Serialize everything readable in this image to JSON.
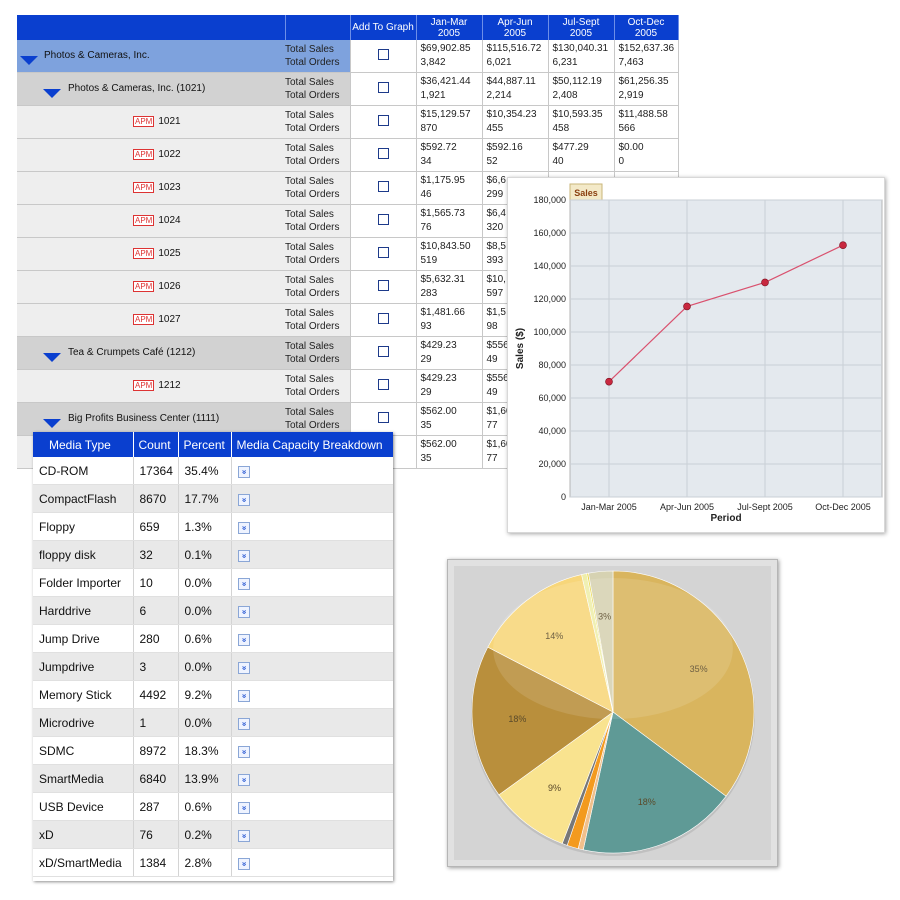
{
  "sales_table": {
    "headers": {
      "add_to_graph": "Add To Graph",
      "q1": "Jan-Mar\n2005",
      "q2": "Apr-Jun\n2005",
      "q3": "Jul-Sept\n2005",
      "q4": "Oct-Dec\n2005"
    },
    "metric_sales": "Total Sales",
    "metric_orders": "Total Orders",
    "rows": [
      {
        "level": 0,
        "name": "Photos & Cameras, Inc.",
        "apm": false,
        "sales": [
          "$69,902.85",
          "$115,516.72",
          "$130,040.31",
          "$152,637.36"
        ],
        "orders": [
          "3,842",
          "6,021",
          "6,231",
          "7,463"
        ]
      },
      {
        "level": 1,
        "name": "Photos & Cameras, Inc. (1021)",
        "apm": false,
        "sales": [
          "$36,421.44",
          "$44,887.11",
          "$50,112.19",
          "$61,256.35"
        ],
        "orders": [
          "1,921",
          "2,214",
          "2,408",
          "2,919"
        ]
      },
      {
        "level": 2,
        "name": "1021",
        "apm": true,
        "sales": [
          "$15,129.57",
          "$10,354.23",
          "$10,593.35",
          "$11,488.58"
        ],
        "orders": [
          "870",
          "455",
          "458",
          "566"
        ]
      },
      {
        "level": 2,
        "name": "1022",
        "apm": true,
        "sales": [
          "$592.72",
          "$592.16",
          "$477.29",
          "$0.00"
        ],
        "orders": [
          "34",
          "52",
          "40",
          "0"
        ]
      },
      {
        "level": 2,
        "name": "1023",
        "apm": true,
        "sales": [
          "$1,175.95",
          "$6,6",
          "",
          ""
        ],
        "orders": [
          "46",
          "299",
          "",
          ""
        ]
      },
      {
        "level": 2,
        "name": "1024",
        "apm": true,
        "sales": [
          "$1,565.73",
          "$6,4",
          "",
          ""
        ],
        "orders": [
          "76",
          "320",
          "",
          ""
        ]
      },
      {
        "level": 2,
        "name": "1025",
        "apm": true,
        "sales": [
          "$10,843.50",
          "$8,5",
          "",
          ""
        ],
        "orders": [
          "519",
          "393",
          "",
          ""
        ]
      },
      {
        "level": 2,
        "name": "1026",
        "apm": true,
        "sales": [
          "$5,632.31",
          "$10,",
          "",
          ""
        ],
        "orders": [
          "283",
          "597",
          "",
          ""
        ]
      },
      {
        "level": 2,
        "name": "1027",
        "apm": true,
        "sales": [
          "$1,481.66",
          "$1,5",
          "",
          ""
        ],
        "orders": [
          "93",
          "98",
          "",
          ""
        ]
      },
      {
        "level": 1,
        "name": "Tea & Crumpets Café (1212)",
        "apm": false,
        "sales": [
          "$429.23",
          "$556",
          "",
          ""
        ],
        "orders": [
          "29",
          "49",
          "",
          ""
        ]
      },
      {
        "level": 2,
        "name": "1212",
        "apm": true,
        "sales": [
          "$429.23",
          "$556",
          "",
          ""
        ],
        "orders": [
          "29",
          "49",
          "",
          ""
        ]
      },
      {
        "level": 1,
        "name": "Big Profits Business Center (1111)",
        "apm": false,
        "sales": [
          "$562.00",
          "$1,60",
          "",
          ""
        ],
        "orders": [
          "35",
          "77",
          "",
          ""
        ]
      },
      {
        "level": 2,
        "name": "",
        "apm": false,
        "sales": [
          "$562.00",
          "$1,60",
          "",
          ""
        ],
        "orders": [
          "35",
          "77",
          "",
          ""
        ]
      }
    ]
  },
  "media_table": {
    "headers": [
      "Media Type",
      "Count",
      "Percent",
      "Media Capacity Breakdown"
    ],
    "rows": [
      [
        "CD-ROM",
        "17364",
        "35.4%"
      ],
      [
        "CompactFlash",
        "8670",
        "17.7%"
      ],
      [
        "Floppy",
        "659",
        "1.3%"
      ],
      [
        "floppy disk",
        "32",
        "0.1%"
      ],
      [
        "Folder Importer",
        "10",
        "0.0%"
      ],
      [
        "Harddrive",
        "6",
        "0.0%"
      ],
      [
        "Jump Drive",
        "280",
        "0.6%"
      ],
      [
        "Jumpdrive",
        "3",
        "0.0%"
      ],
      [
        "Memory Stick",
        "4492",
        "9.2%"
      ],
      [
        "Microdrive",
        "1",
        "0.0%"
      ],
      [
        "SDMC",
        "8972",
        "18.3%"
      ],
      [
        "SmartMedia",
        "6840",
        "13.9%"
      ],
      [
        "USB Device",
        "287",
        "0.6%"
      ],
      [
        "xD",
        "76",
        "0.2%"
      ],
      [
        "xD/SmartMedia",
        "1384",
        "2.8%"
      ]
    ]
  },
  "chart_data": [
    {
      "type": "line",
      "tab_label": "Sales",
      "categories": [
        "Jan-Mar 2005",
        "Apr-Jun 2005",
        "Jul-Sept 2005",
        "Oct-Dec 2005"
      ],
      "values": [
        69902.85,
        115516.72,
        130040.31,
        152637.36
      ],
      "xlabel": "Period",
      "ylabel": "Sales ($)",
      "ylim": [
        0,
        180000
      ],
      "yticks": [
        "0",
        "20,000",
        "40,000",
        "60,000",
        "80,000",
        "100,000",
        "120,000",
        "140,000",
        "160,000",
        "180,000"
      ],
      "grid": true,
      "line_color": "#d9516e",
      "marker_color": "#c8283f"
    },
    {
      "type": "pie",
      "slices": [
        {
          "label": "35%",
          "value": 35.4,
          "color": "#d9b55e"
        },
        {
          "label": "18%",
          "value": 18.3,
          "color": "#5f9a96"
        },
        {
          "label": "",
          "value": 0.6,
          "color": "#f0c08c"
        },
        {
          "label": "",
          "value": 1.3,
          "color": "#f39a1e"
        },
        {
          "label": "",
          "value": 0.6,
          "color": "#777777"
        },
        {
          "label": "9%",
          "value": 9.2,
          "color": "#f9e38f"
        },
        {
          "label": "18%",
          "value": 17.7,
          "color": "#b98f3c"
        },
        {
          "label": "14%",
          "value": 13.9,
          "color": "#f7d67a"
        },
        {
          "label": "",
          "value": 0.6,
          "color": "#eeeeaa"
        },
        {
          "label": "",
          "value": 0.2,
          "color": "#e8d84b"
        },
        {
          "label": "3%",
          "value": 2.8,
          "color": "#d6d2b2"
        }
      ]
    }
  ]
}
